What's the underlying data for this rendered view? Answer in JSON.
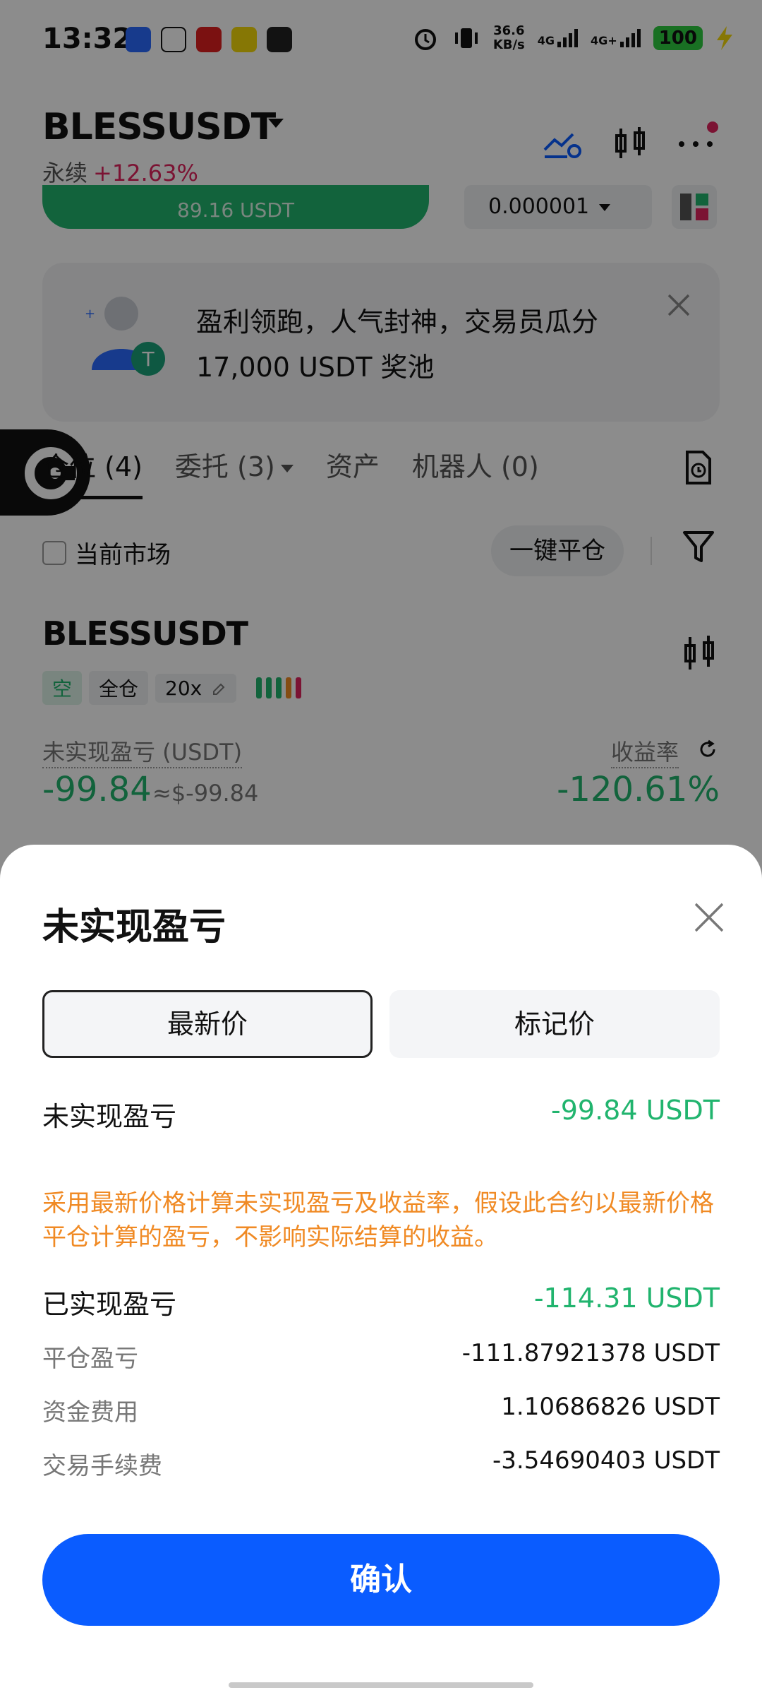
{
  "status_bar": {
    "time": "13:32",
    "net_speed_value": "36.6",
    "net_speed_unit": "KB/s",
    "net1": "4G",
    "net2": "4G+",
    "battery": "100"
  },
  "header": {
    "pair": "BLESSUSDT",
    "contract_type": "永续",
    "change": "+12.63%",
    "bar_text": "89.16 USDT",
    "precision": "0.000001"
  },
  "banner": {
    "line1": "盈利领跑，人气封神，交易员瓜分",
    "line2": "17,000 USDT 奖池"
  },
  "tabs": [
    {
      "label": "仓位 (4)"
    },
    {
      "label": "委托 (3)"
    },
    {
      "label": "资产"
    },
    {
      "label": "机器人 (0)"
    }
  ],
  "filters": {
    "current_market": "当前市场",
    "close_all": "一键平仓"
  },
  "position": {
    "pair": "BLESSUSDT",
    "side": "空",
    "margin_mode": "全仓",
    "leverage": "20x",
    "pnl_label": "未实现盈亏 (USDT)",
    "pnl_value": "-99.84",
    "pnl_approx": "≈$-99.84",
    "roe_label": "收益率",
    "roe_value": "-120.61%"
  },
  "sheet": {
    "title": "未实现盈亏",
    "tab_latest": "最新价",
    "tab_mark": "标记价",
    "unrealized_label": "未实现盈亏",
    "unrealized_value": "-99.84 USDT",
    "note": "采用最新价格计算未实现盈亏及收益率，假设此合约以最新价格平仓计算的盈亏，不影响实际结算的收益。",
    "realized_label": "已实现盈亏",
    "realized_value": "-114.31 USDT",
    "close_pnl_label": "平仓盈亏",
    "close_pnl_value": "-111.87921378 USDT",
    "funding_label": "资金费用",
    "funding_value": "1.10686826 USDT",
    "fee_label": "交易手续费",
    "fee_value": "-3.54690403 USDT",
    "confirm": "确认"
  },
  "colors": {
    "green": "#21b46e",
    "red": "#e0245e",
    "orange": "#f08a24",
    "blue": "#0a5cff"
  },
  "icons": [
    "alarm-icon",
    "vibrate-icon",
    "caret-down-icon",
    "price-alert-icon",
    "chart-icon",
    "more-icon",
    "layout-icon",
    "close-icon",
    "history-icon",
    "filter-icon",
    "edit-icon",
    "refresh-icon"
  ]
}
